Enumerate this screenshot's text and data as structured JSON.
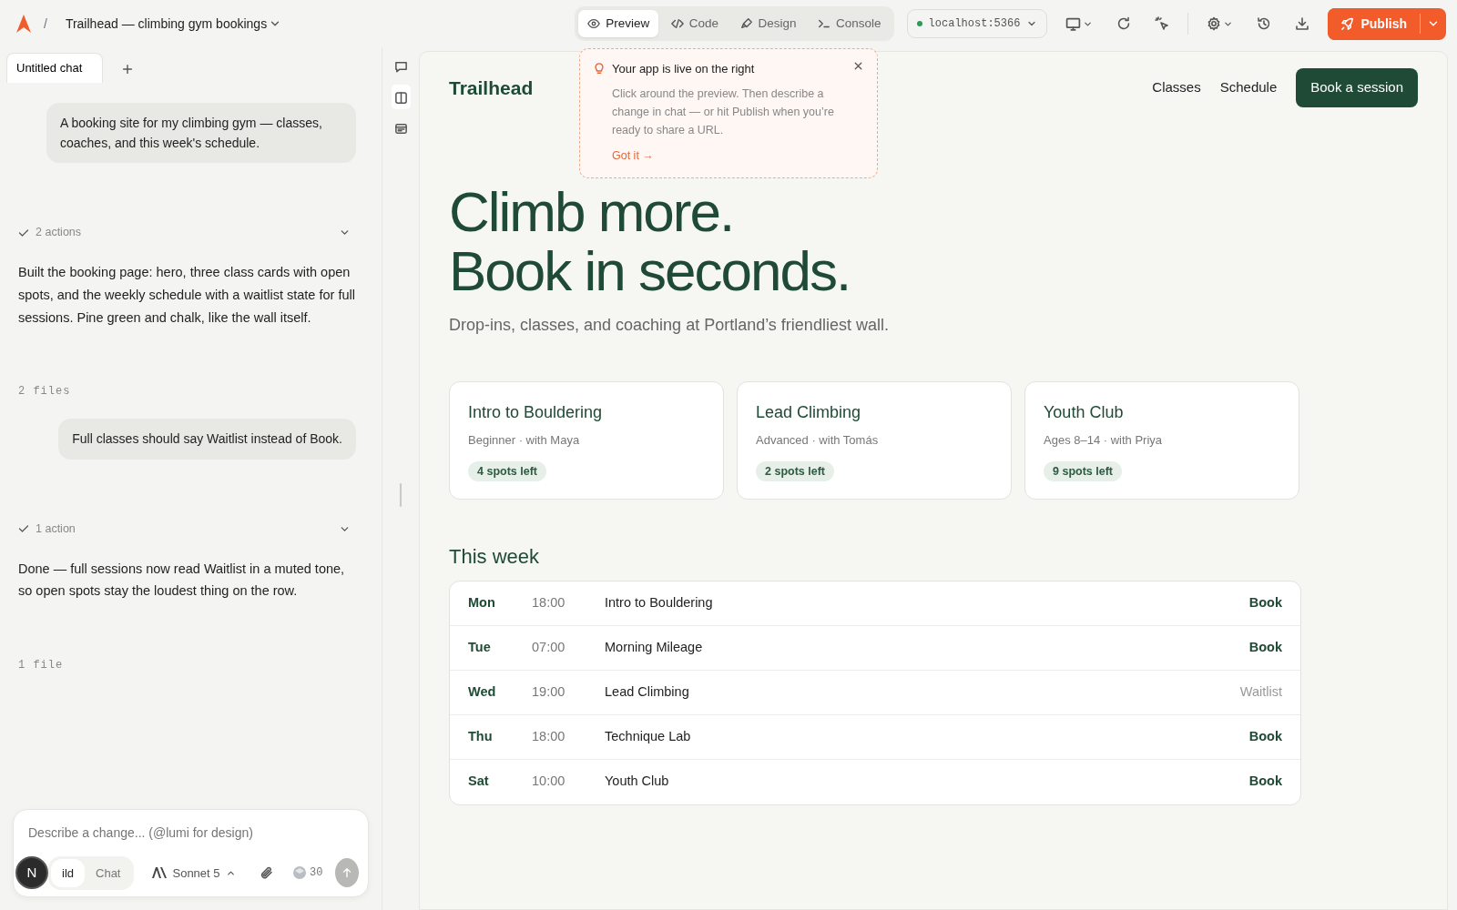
{
  "topbar": {
    "separator": "/",
    "project_title": "Trailhead — climbing gym bookings",
    "view_tabs": [
      {
        "label": "Preview",
        "selected": true
      },
      {
        "label": "Code",
        "selected": false
      },
      {
        "label": "Design",
        "selected": false
      },
      {
        "label": "Console",
        "selected": false
      }
    ],
    "url": "localhost:5366",
    "publish": "Publish"
  },
  "chat": {
    "tabs": [
      {
        "label": "Untitled chat",
        "selected": true
      }
    ],
    "messages": [
      {
        "kind": "user",
        "text": "A booking site for my climbing gym — classes, coaches, and this week's schedule."
      },
      {
        "kind": "actions",
        "text": "2 actions"
      },
      {
        "kind": "reply",
        "text": "Built the booking page: hero, three class cards with open spots, and the weekly schedule with a waitlist state for full sessions. Pine green and chalk, like the wall itself."
      },
      {
        "kind": "files",
        "text": "2 files"
      },
      {
        "kind": "user",
        "text": "Full classes should say Waitlist instead of Book."
      },
      {
        "kind": "actions",
        "text": "1 action"
      },
      {
        "kind": "reply",
        "text": "Done — full sessions now read Waitlist in a muted tone, so open spots stay the loudest thing on the row."
      },
      {
        "kind": "files",
        "text": "1 file"
      }
    ],
    "composer": {
      "placeholder": "Describe a change... (@lumi for design)",
      "modes": [
        {
          "label": "ild",
          "selected": true
        },
        {
          "label": "Chat",
          "selected": false
        }
      ],
      "model": "Sonnet 5",
      "credits": "30",
      "avatar": "N"
    }
  },
  "tip": {
    "title": "Your app is live on the right",
    "body": "Click around the preview. Then describe a change in chat — or hit Publish when you’re ready to share a URL.",
    "link": "Got it →"
  },
  "preview": {
    "brand": "Trailhead",
    "nav": [
      "Classes",
      "Schedule"
    ],
    "cta": "Book a session",
    "hero": [
      "Climb more.",
      "Book in seconds."
    ],
    "subtitle": "Drop-ins, classes, and coaching at Portland’s friendliest wall.",
    "classes": [
      {
        "name": "Intro to Bouldering",
        "meta": "Beginner · with Maya",
        "spots": "4 spots left"
      },
      {
        "name": "Lead Climbing",
        "meta": "Advanced · with Tomás",
        "spots": "2 spots left"
      },
      {
        "name": "Youth Club",
        "meta": "Ages 8–14 · with Priya",
        "spots": "9 spots left"
      }
    ],
    "schedule_title": "This week",
    "sessions": [
      {
        "day": "Mon",
        "time": "18:00",
        "name": "Intro to Bouldering",
        "action": "Book",
        "full": false
      },
      {
        "day": "Tue",
        "time": "07:00",
        "name": "Morning Mileage",
        "action": "Book",
        "full": false
      },
      {
        "day": "Wed",
        "time": "19:00",
        "name": "Lead Climbing",
        "action": "Waitlist",
        "full": true
      },
      {
        "day": "Thu",
        "time": "18:00",
        "name": "Technique Lab",
        "action": "Book",
        "full": false
      },
      {
        "day": "Sat",
        "time": "10:00",
        "name": "Youth Club",
        "action": "Book",
        "full": false
      }
    ]
  }
}
